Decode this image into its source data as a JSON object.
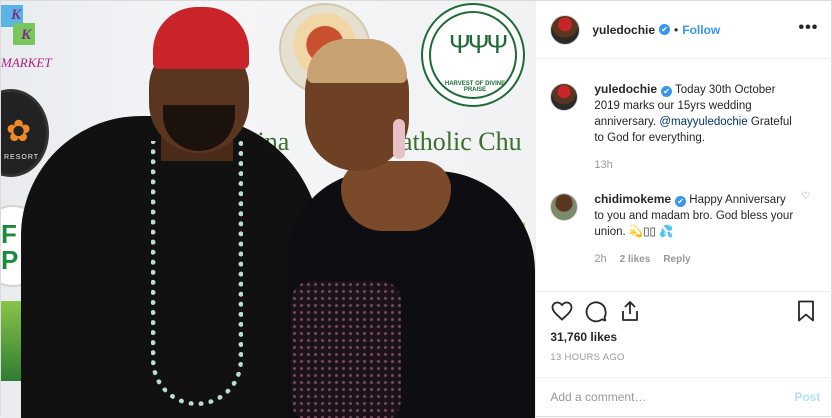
{
  "photo": {
    "background_logos": {
      "km_letter_top": "K",
      "km_letter_bottom": "K",
      "km_text": "MARKET",
      "resort_text": "RESORT",
      "fcp_text": "F C P",
      "harvest_label": "HARVEST OF DIVINE PRAISE",
      "banner_left": "egina",
      "banner_right": "atholic Chu"
    }
  },
  "header": {
    "username": "yuledochie",
    "verified_mark": "✔",
    "separator": "•",
    "follow_label": "Follow",
    "more_label": "•••"
  },
  "caption": {
    "username": "yuledochie",
    "verified_mark": "✔",
    "text_before_mention": " Today 30th October 2019 marks our 15yrs wedding anniversary. ",
    "mention": "@mayyuledochie",
    "text_after_mention": " Grateful to God for everything.",
    "time": "13h"
  },
  "comment": {
    "username": "chidimokeme",
    "verified_mark": "✔",
    "text": " Happy Anniversary to you and madam bro. God bless your union. 💫▯▯ 💦",
    "time": "2h",
    "likes": "2 likes",
    "reply_label": "Reply",
    "like_icon": "♡"
  },
  "actions": {
    "like_icon": "heart-icon",
    "comment_icon": "comment-icon",
    "share_icon": "share-icon",
    "save_icon": "bookmark-icon",
    "likes_count": "31,760 likes",
    "time_ago": "13 HOURS AGO"
  },
  "add_comment": {
    "placeholder": "Add a comment…",
    "post_label": "Post"
  },
  "colors": {
    "link_blue": "#3897f0",
    "post_disabled": "#b2dffc",
    "border": "#dbdbdb"
  }
}
